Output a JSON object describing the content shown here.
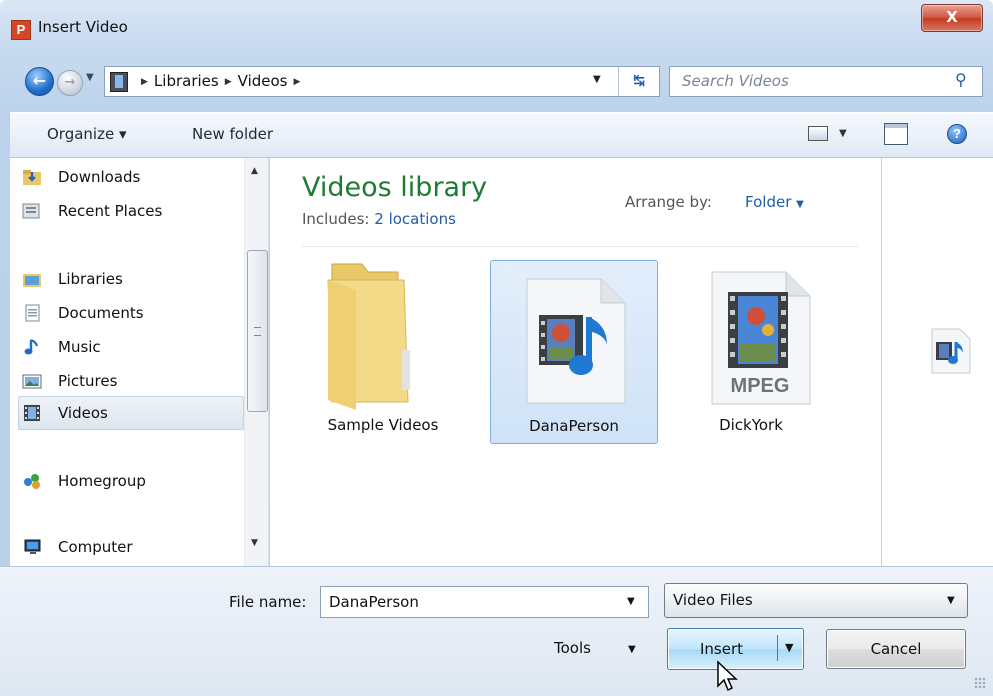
{
  "window": {
    "title": "Insert Video",
    "app_icon_letter": "P",
    "close_glyph": "X"
  },
  "nav": {
    "breadcrumb": [
      "Libraries",
      "Videos"
    ],
    "search_placeholder": "Search Videos",
    "icons": [
      "back-arrow-icon",
      "forward-arrow-icon",
      "refresh-icon",
      "search-icon"
    ]
  },
  "toolbar": {
    "organize": "Organize ▾",
    "new_folder": "New folder"
  },
  "sidebar": {
    "items": [
      {
        "label": "Downloads",
        "icon": "downloads-folder-icon"
      },
      {
        "label": "Recent Places",
        "icon": "recent-places-icon"
      },
      {
        "label": "Libraries",
        "icon": "libraries-icon"
      },
      {
        "label": "Documents",
        "icon": "documents-icon"
      },
      {
        "label": "Music",
        "icon": "music-icon"
      },
      {
        "label": "Pictures",
        "icon": "pictures-icon"
      },
      {
        "label": "Videos",
        "icon": "videos-icon",
        "selected": true
      },
      {
        "label": "Homegroup",
        "icon": "homegroup-icon"
      },
      {
        "label": "Computer",
        "icon": "computer-icon"
      }
    ]
  },
  "library": {
    "title": "Videos library",
    "includes_label": "Includes:",
    "includes_link": "2 locations",
    "arrange_label": "Arrange by:",
    "arrange_value": "Folder",
    "files": [
      {
        "name": "Sample Videos",
        "type": "folder"
      },
      {
        "name": "DanaPerson",
        "type": "video-audio",
        "selected": true
      },
      {
        "name": "DickYork",
        "type": "mpeg",
        "badge": "MPEG"
      }
    ]
  },
  "footer": {
    "file_name_label": "File name:",
    "file_name_value": "DanaPerson",
    "file_type": "Video Files",
    "tools": "Tools",
    "insert": "Insert",
    "cancel": "Cancel"
  },
  "colors": {
    "library_title": "#1e7b33",
    "link": "#1d5ea8",
    "selection": "#cfe2f7"
  }
}
